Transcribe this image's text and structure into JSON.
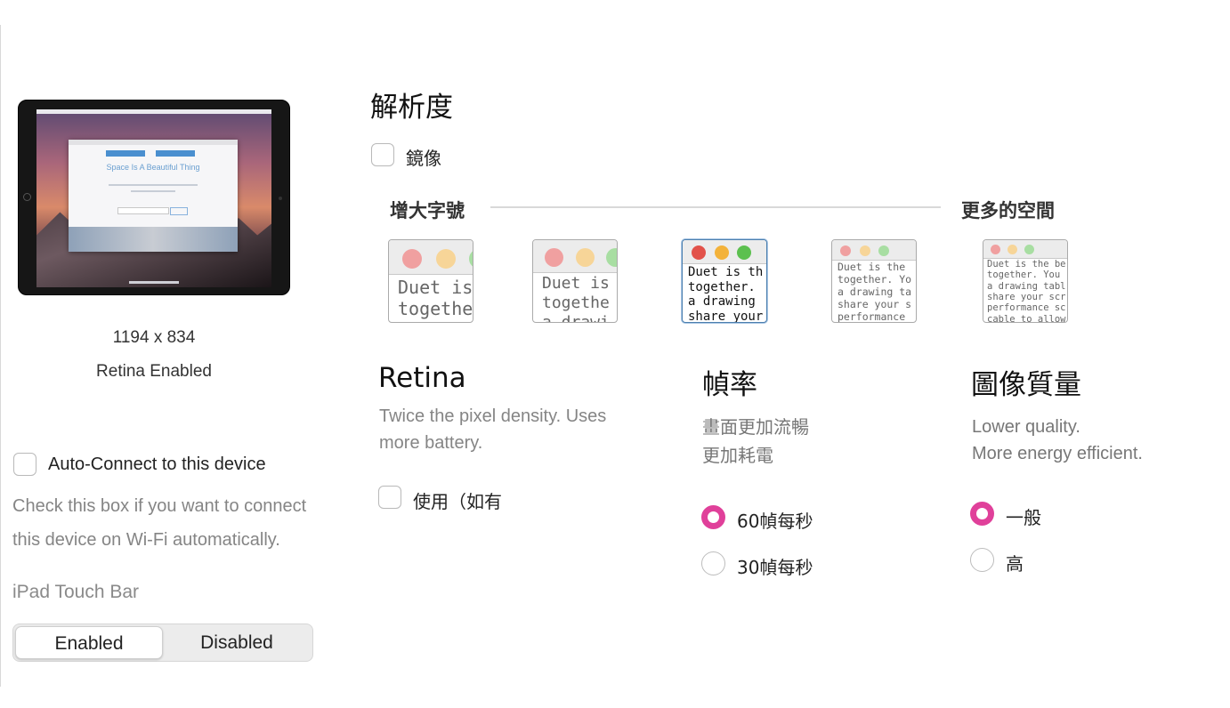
{
  "device": {
    "resolution": "1194 x 834",
    "retina_status": "Retina Enabled",
    "preview_heading": "Space Is A Beautiful Thing"
  },
  "auto_connect": {
    "label": "Auto-Connect to this device",
    "checked": false,
    "help_line_1": "Check this box if you want to connect",
    "help_line_2": "this device on Wi-Fi automatically."
  },
  "touch_bar": {
    "label": "iPad Touch Bar",
    "options": [
      "Enabled",
      "Disabled"
    ],
    "selected": "Enabled"
  },
  "resolution_section": {
    "title": "解析度",
    "mirror_label": "鏡像",
    "mirror_checked": false,
    "scale_min_label": "增大字號",
    "scale_max_label": "更多的空間",
    "scale_selected_index": 2,
    "thumbs": [
      {
        "line1": "Duet is",
        "line2": "togethe"
      },
      {
        "line1": "Duet is",
        "line2": "togethe",
        "line3": "a drawi"
      },
      {
        "line1": "Duet is th",
        "line2": "together.",
        "line3": "a drawing",
        "line4": "share your"
      },
      {
        "line1": "Duet is the",
        "line2": "together. Yo",
        "line3": "a drawing ta",
        "line4": "share your s",
        "line5": "performance"
      },
      {
        "line1": "Duet is the be",
        "line2": "together. You",
        "line3": "a drawing tabl",
        "line4": "share your scr",
        "line5": "performance sc",
        "line6": "cable to allow"
      }
    ]
  },
  "retina": {
    "title": "Retina",
    "desc_line_1": "Twice the pixel density. Uses",
    "desc_line_2": "more battery.",
    "use_label": "使用（如有",
    "use_checked": false
  },
  "frame_rate": {
    "title": "幀率",
    "desc_line_1": "畫面更加流暢",
    "desc_line_2": "更加耗電",
    "options": [
      "60幀每秒",
      "30幀每秒"
    ],
    "selected": "60幀每秒"
  },
  "image_quality": {
    "title": "圖像質量",
    "desc_line_1": "Lower quality.",
    "desc_line_2": "More energy efficient.",
    "options": [
      "一般",
      "高"
    ],
    "selected": "一般"
  },
  "colors": {
    "accent_radio": "#e0409a",
    "traffic_red": "#e2524a",
    "traffic_yellow": "#f3b23a",
    "traffic_green": "#5cc04f"
  }
}
